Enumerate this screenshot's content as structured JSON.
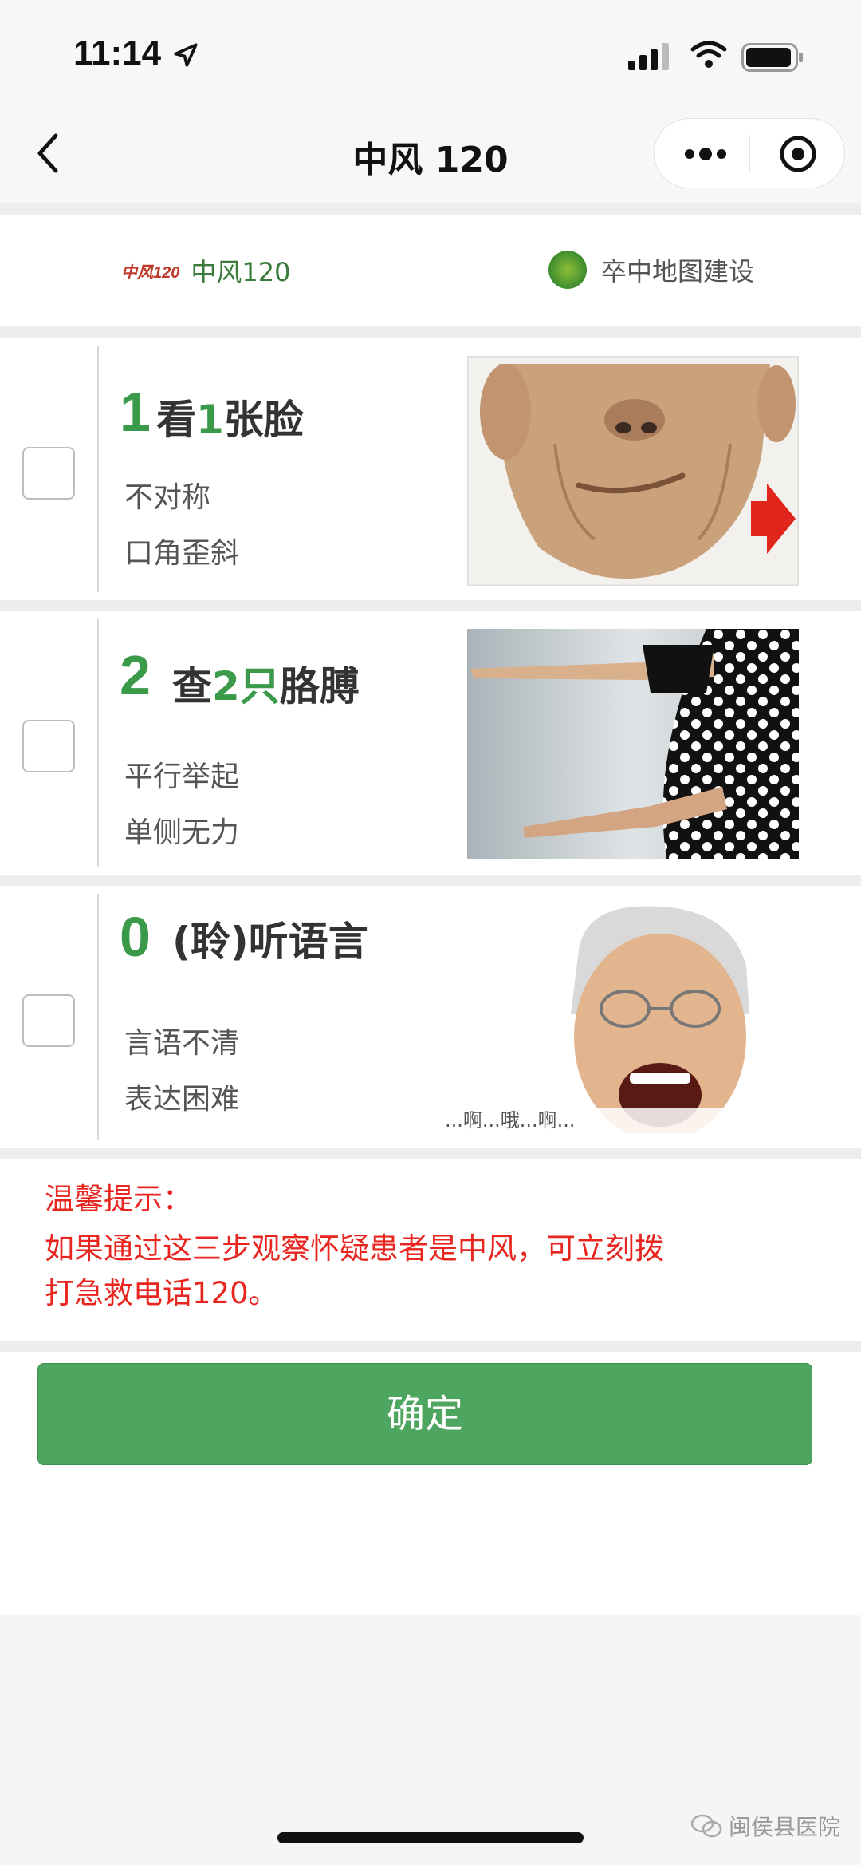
{
  "status_bar": {
    "time": "11:14"
  },
  "nav": {
    "title": "中风 120"
  },
  "brand": {
    "left_mini": "中风120",
    "left_text": "中风120",
    "right_text": "卒中地图建设"
  },
  "steps": [
    {
      "num": "1",
      "title_a": "看",
      "title_b": "1",
      "title_c": "张脸",
      "line1": "不对称",
      "line2": "口角歪斜"
    },
    {
      "num": "2",
      "title_a": "查",
      "title_b": "2只",
      "title_c": "胳膊",
      "line1": "平行举起",
      "line2": "单侧无力"
    },
    {
      "num": "0",
      "title_a": "(聆)听语言",
      "title_b": "",
      "title_c": "",
      "line1": "言语不清",
      "line2": "表达困难"
    }
  ],
  "photo3_caption": "...啊...哦...啊...",
  "tip": {
    "title": "温馨提示：",
    "line1": "如果通过这三步观察怀疑患者是中风，可立刻拨",
    "line2": "打急救电话120。"
  },
  "confirm_label": "确定",
  "watermark": "闽侯县医院",
  "colors": {
    "accent_green": "#4ea55f",
    "step_green": "#3b9a4a",
    "tip_red": "#e8261f"
  }
}
